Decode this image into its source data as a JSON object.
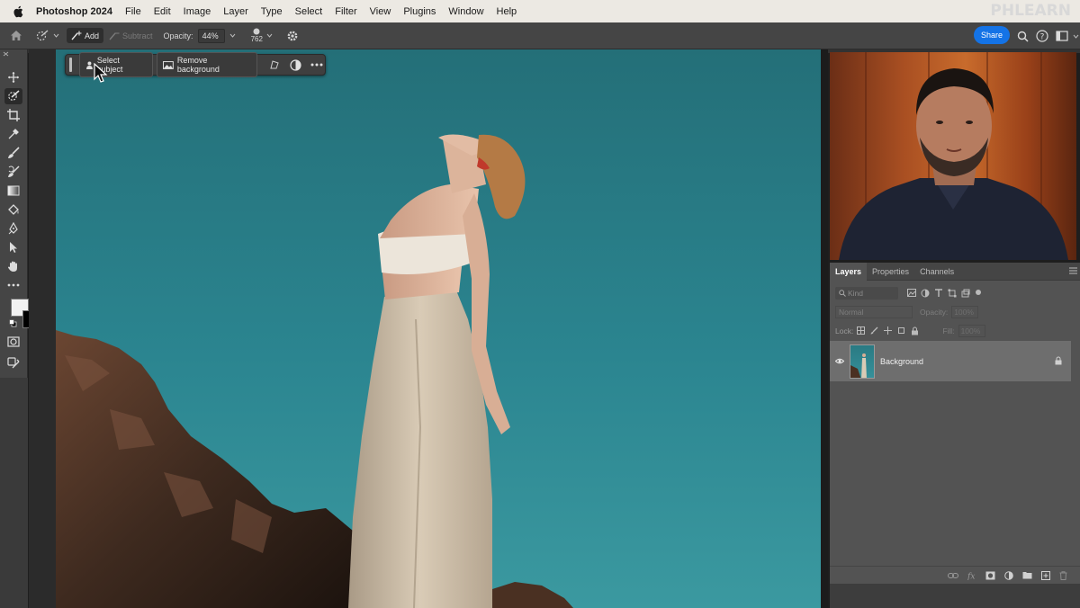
{
  "menubar": {
    "app_name": "Photoshop 2024",
    "items": [
      "File",
      "Edit",
      "Image",
      "Layer",
      "Type",
      "Select",
      "Filter",
      "View",
      "Plugins",
      "Window",
      "Help"
    ],
    "brand": "PHLEARN"
  },
  "optionsbar": {
    "add_label": "Add",
    "subtract_label": "Subtract",
    "opacity_label": "Opacity:",
    "opacity_value": "44%",
    "brush_size": "762",
    "share_label": "Share"
  },
  "taskbar": {
    "select_subject_label": "Select subject",
    "remove_background_label": "Remove background"
  },
  "layers_panel": {
    "tabs": [
      "Layers",
      "Properties",
      "Channels"
    ],
    "active_tab": "Layers",
    "filter_placeholder": "Kind",
    "blend_mode": "Normal",
    "opacity_label": "Opacity:",
    "opacity_value": "100%",
    "lock_label": "Lock:",
    "fill_label": "Fill:",
    "fill_value": "100%",
    "layers": [
      {
        "name": "Background",
        "visible": true,
        "locked": true
      }
    ]
  },
  "colors": {
    "accent": "#1473e6",
    "canvas_sky": "#2b8590",
    "foreground_color": "#f2f2f2",
    "background_color": "#000000"
  }
}
